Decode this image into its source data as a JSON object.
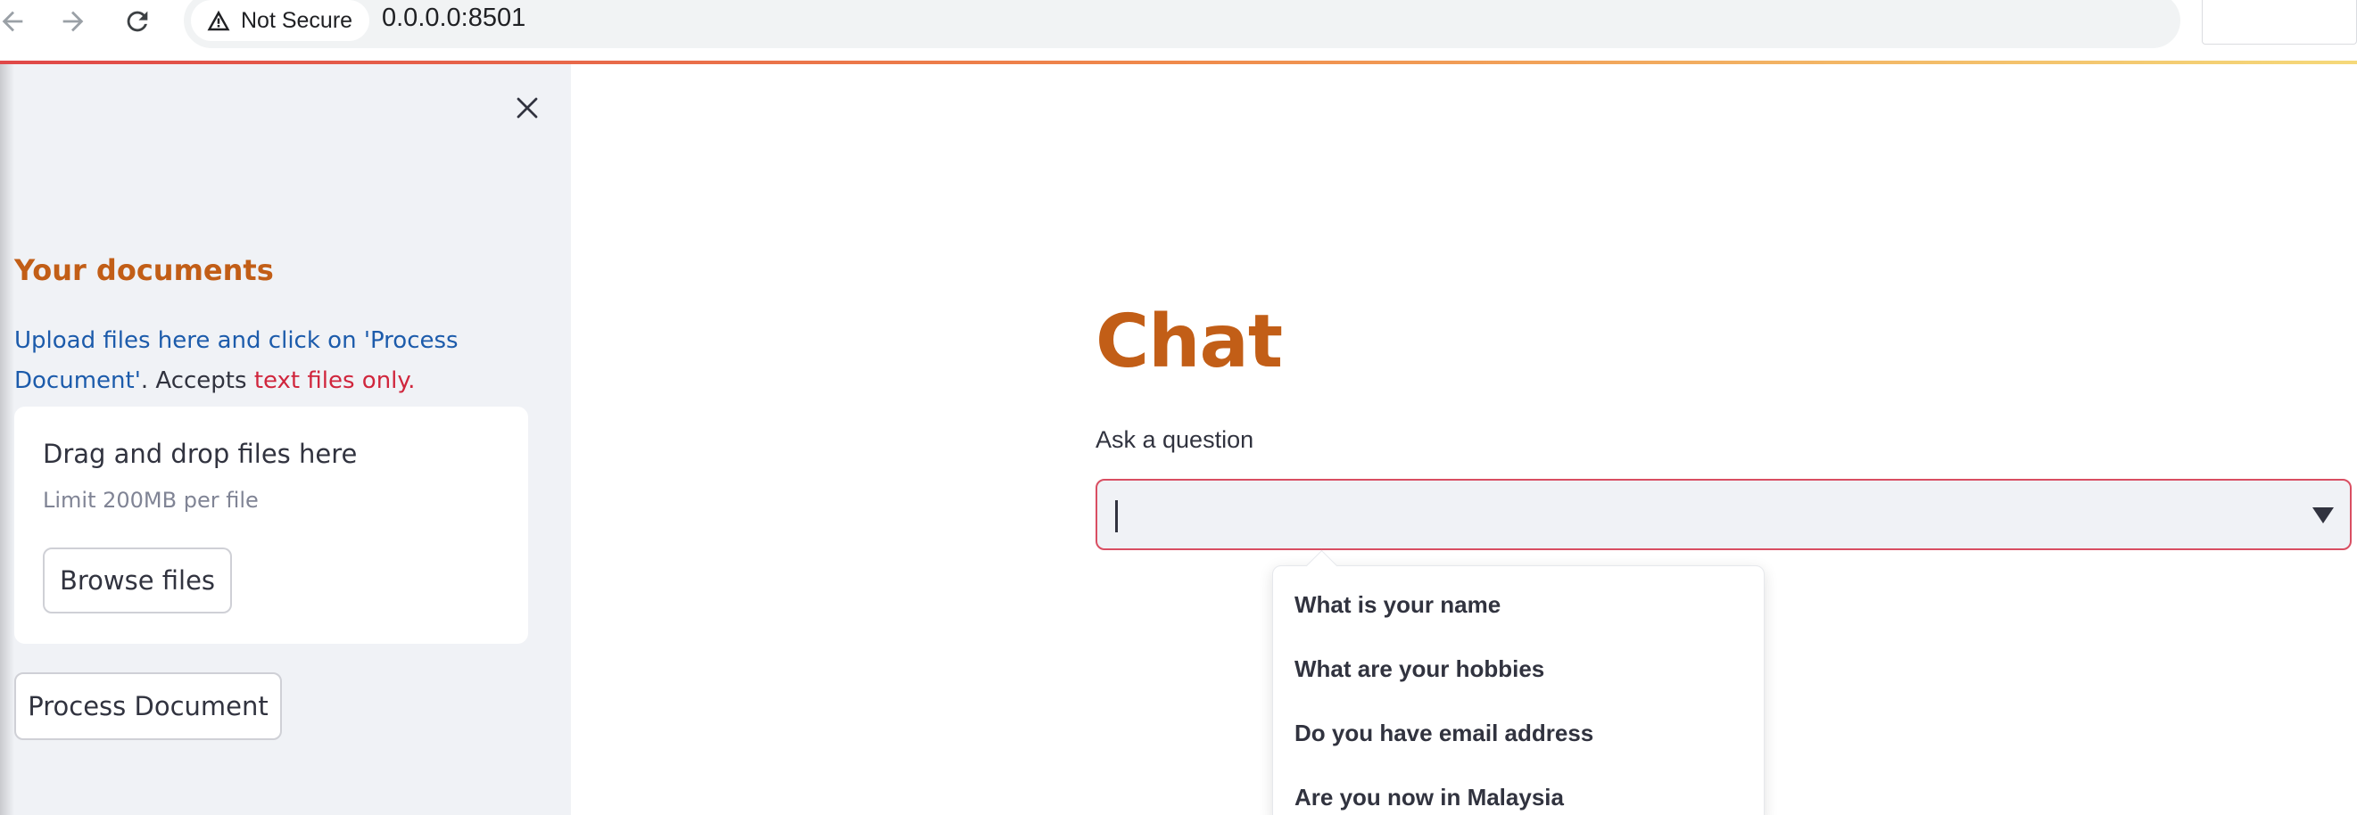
{
  "browser": {
    "security_label": "Not Secure",
    "url": "0.0.0.0:8501"
  },
  "sidebar": {
    "heading": "Your documents",
    "desc_part1": "Upload files here and click on 'Process Document'",
    "desc_part2": ". Accepts ",
    "desc_part3": "text files only.",
    "dropzone_title": "Drag and drop files here",
    "dropzone_limit": "Limit 200MB per file",
    "browse_label": "Browse files",
    "process_label": "Process Document"
  },
  "main": {
    "title": "Chat",
    "question_label": "Ask a question",
    "input_value": "",
    "options": [
      "What is your name",
      "What are your hobbies",
      "Do you have email address",
      "Are you now in Malaysia"
    ]
  },
  "colors": {
    "accent_orange": "#c25e17",
    "link_blue": "#1c5bab",
    "warning_red": "#d0263d",
    "focus_border": "#d94e62",
    "sidebar_bg": "#f0f2f6"
  }
}
